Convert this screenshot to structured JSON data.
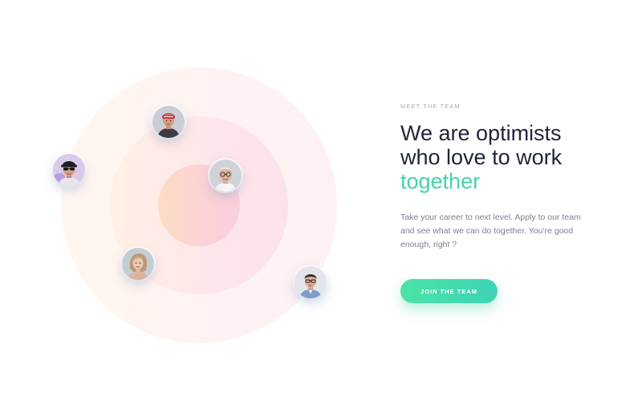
{
  "section": {
    "eyebrow": "MEET THE TEAM",
    "headline": {
      "line1": "We are optimists",
      "line2": "who love to work",
      "accent": "together"
    },
    "body": "Take your career to next level. Apply to our team and see what we can do together. You're good enough, right ?",
    "cta_label": "JOIN THE TEAM"
  },
  "colors": {
    "accent": "#42d4a8",
    "heading": "#1f2538",
    "body": "#7b8193",
    "eyebrow": "#a7acb8",
    "button_gradient_start": "#4ae3a6",
    "button_gradient_end": "#3ed3b6"
  },
  "team_avatars": [
    {
      "name": "team-member-red-cap",
      "icon": "person-avatar"
    },
    {
      "name": "team-member-sunglasses",
      "icon": "person-avatar"
    },
    {
      "name": "team-member-glasses-bald",
      "icon": "person-avatar"
    },
    {
      "name": "team-member-blonde-woman",
      "icon": "person-avatar"
    },
    {
      "name": "team-member-glasses-man",
      "icon": "person-avatar"
    }
  ]
}
